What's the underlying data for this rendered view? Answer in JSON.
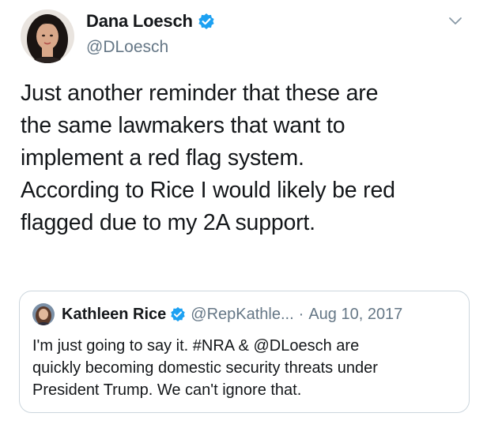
{
  "tweet": {
    "author": {
      "display_name": "Dana Loesch",
      "handle": "@DLoesch",
      "avatar_icon": "profile-photo",
      "verified_icon": "verified-badge-icon"
    },
    "text": "Just another reminder that these are\nthe same lawmakers that want to\nimplement a red flag system.\nAccording to Rice I would likely be red\nflagged due to my 2A support.",
    "menu_icon": "chevron-down-icon",
    "quoted": {
      "display_name": "Kathleen Rice",
      "handle": "@RepKathle...",
      "separator": "·",
      "date": "Aug 10, 2017",
      "text": "I'm just going to say it. #NRA & @DLoesch are\nquickly becoming domestic security threats under\nPresident Trump. We can't ignore that."
    }
  },
  "colors": {
    "accent": "#1da1f2",
    "secondary_text": "#657786",
    "border": "#ccd6dd"
  }
}
